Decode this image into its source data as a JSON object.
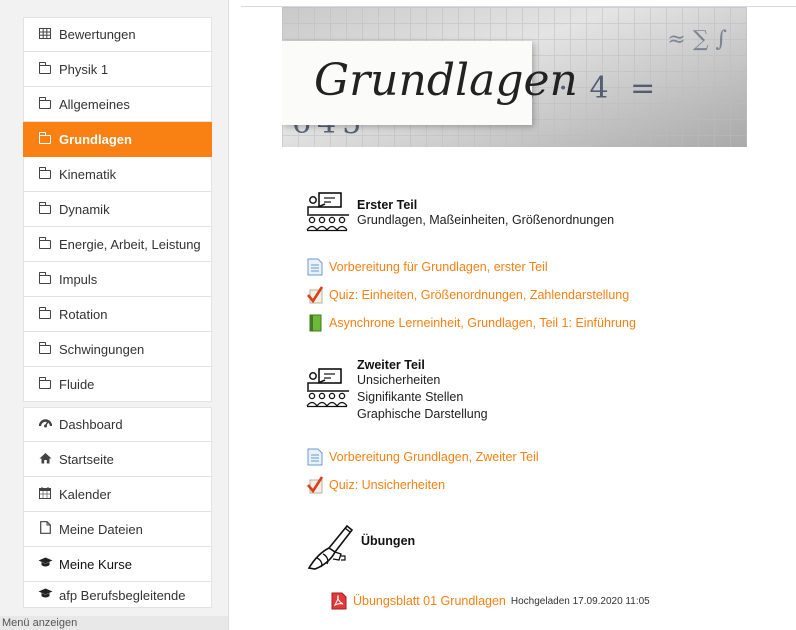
{
  "sidebar": {
    "items": [
      {
        "label": "Bewertungen",
        "icon": "table-icon"
      },
      {
        "label": "Physik 1",
        "icon": "folder-icon"
      },
      {
        "label": "Allgemeines",
        "icon": "folder-icon"
      },
      {
        "label": "Grundlagen",
        "icon": "folder-icon",
        "active": true
      },
      {
        "label": "Kinematik",
        "icon": "folder-icon"
      },
      {
        "label": "Dynamik",
        "icon": "folder-icon"
      },
      {
        "label": "Energie, Arbeit, Leistung",
        "icon": "folder-icon"
      },
      {
        "label": "Impuls",
        "icon": "folder-icon"
      },
      {
        "label": "Rotation",
        "icon": "folder-icon"
      },
      {
        "label": "Schwingungen",
        "icon": "folder-icon"
      },
      {
        "label": "Fluide",
        "icon": "folder-icon"
      }
    ],
    "items2": [
      {
        "label": "Dashboard",
        "icon": "dashboard-icon"
      },
      {
        "label": "Startseite",
        "icon": "home-icon"
      },
      {
        "label": "Kalender",
        "icon": "calendar-icon"
      },
      {
        "label": "Meine Dateien",
        "icon": "file-icon"
      },
      {
        "label": "Meine Kurse",
        "icon": "graduation-cap-icon"
      },
      {
        "label": "afp Berufsbegleitende",
        "icon": "graduation-cap-icon"
      }
    ],
    "menu_hint": "Menü anzeigen"
  },
  "banner": {
    "title": "Grundlagen",
    "formula": "Ec = 1/3 · 1 · 4 = 645"
  },
  "section1": {
    "title": "Erster Teil",
    "lines": [
      "Grundlagen, Maßeinheiten, Größenordnungen"
    ]
  },
  "activities1": [
    {
      "label": "Vorbereitung für Grundlagen, erster Teil",
      "icon": "page-icon"
    },
    {
      "label": "Quiz: Einheiten, Größenordnungen, Zahlendarstellung",
      "icon": "quiz-icon"
    },
    {
      "label": "Asynchrone Lerneinheit, Grundlagen, Teil 1: Einführung",
      "icon": "book-icon"
    }
  ],
  "section2": {
    "title": "Zweiter Teil",
    "lines": [
      "Unsicherheiten",
      "Signifikante Stellen",
      "Graphische Darstellung"
    ]
  },
  "activities2": [
    {
      "label": "Vorbereitung Grundlagen, Zweiter Teil",
      "icon": "page-icon"
    },
    {
      "label": "Quiz: Unsicherheiten",
      "icon": "quiz-icon"
    }
  ],
  "section3": {
    "title": "Übungen"
  },
  "file": {
    "label": "Übungsblatt 01 Grundlagen",
    "meta": "Hochgeladen 17.09.2020 11:05",
    "icon": "pdf-icon"
  },
  "colors": {
    "accent": "#f98012"
  }
}
